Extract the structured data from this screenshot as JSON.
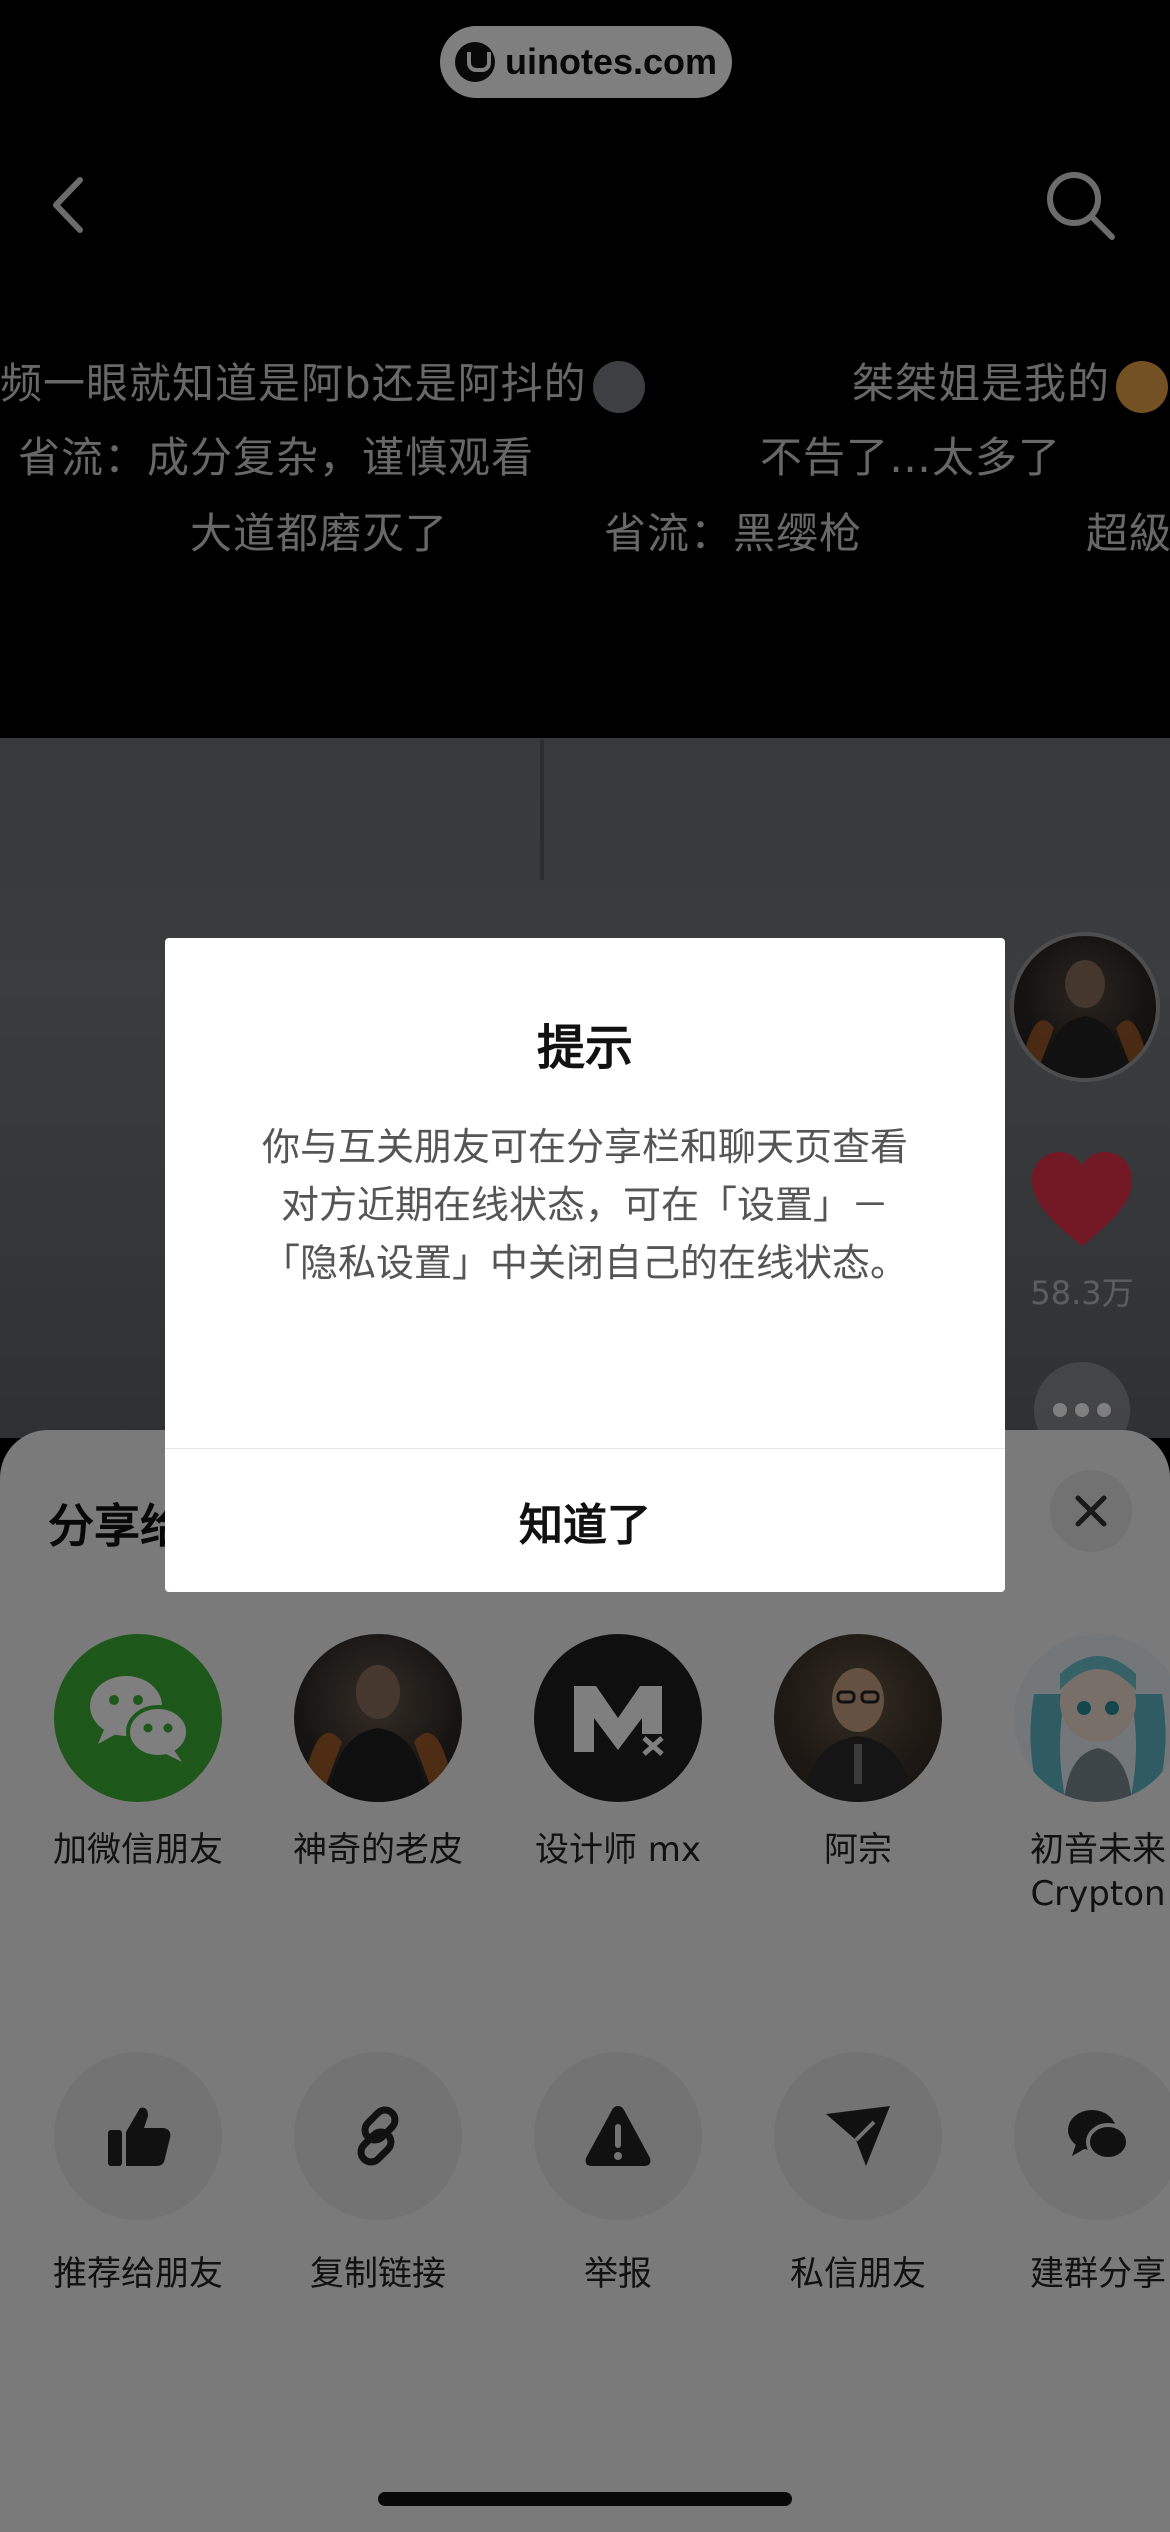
{
  "watermark": {
    "text": "uinotes.com"
  },
  "danmaku": [
    "频一眼就知道是阿b还是阿抖的",
    "桀桀姐是我的",
    "省流：成分复杂，谨慎观看",
    "不告了…太多了",
    "大道都磨灭了",
    "省流：黑缨枪",
    "超級"
  ],
  "video": {
    "likes": "58.3万"
  },
  "share_sheet": {
    "title": "分享给",
    "contacts": [
      {
        "label": "加微信朋友",
        "icon": "wechat-icon"
      },
      {
        "label": "神奇的老皮"
      },
      {
        "label": "设计师 mx"
      },
      {
        "label": "阿宗"
      },
      {
        "label": "初音未来",
        "label2": "Crypton"
      }
    ],
    "actions": [
      {
        "label": "推荐给朋友",
        "icon": "thumbs-up-icon"
      },
      {
        "label": "复制链接",
        "icon": "link-icon"
      },
      {
        "label": "举报",
        "icon": "warning-icon"
      },
      {
        "label": "私信朋友",
        "icon": "send-icon"
      },
      {
        "label": "建群分享",
        "icon": "group-chat-icon"
      }
    ]
  },
  "dialog": {
    "title": "提示",
    "body": "你与互关朋友可在分享栏和聊天页查看对方近期在线状态，可在「设置」－「隐私设置」中关闭自己的在线状态。",
    "confirm": "知道了"
  },
  "colors": {
    "wechat_green": "#3BAF34",
    "heart_red": "#E6304A"
  }
}
